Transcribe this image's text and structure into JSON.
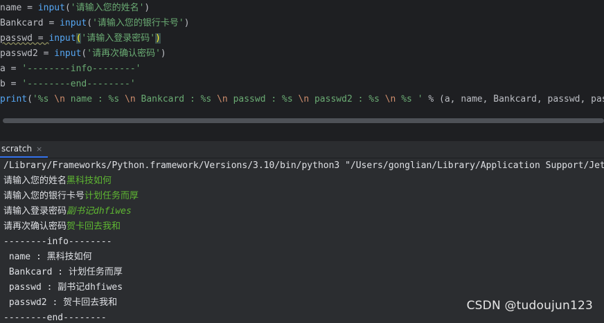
{
  "editor": {
    "line1": {
      "lhs": "name = ",
      "fn": "input",
      "open": "(",
      "str": "'请输入您的姓名'",
      "close": ")"
    },
    "line2": {
      "lhs": "Bankcard = ",
      "fn": "input",
      "open": "(",
      "str": "'请输入您的银行卡号'",
      "close": ")"
    },
    "line3": {
      "lhs": "passwd = ",
      "fn": "input",
      "open": "(",
      "str": "'请输入登录密码'",
      "close": ")"
    },
    "line4": {
      "lhs": "passwd2 = ",
      "fn": "input",
      "open": "(",
      "str": "'请再次确认密码'",
      "close": ")"
    },
    "line5": {
      "lhs": "a = ",
      "str": "'--------info--------'"
    },
    "line6": {
      "lhs": "b = ",
      "str": "'--------end--------'"
    },
    "line7": {
      "fn": "print",
      "open": "(",
      "s1": "'%s ",
      "e1": "\\n",
      "s2": " name : %s ",
      "e2": "\\n",
      "s3": " Bankcard : %s ",
      "e3": "\\n",
      "s4": " passwd : %s ",
      "e4": "\\n",
      "s5": " passwd2 : %s ",
      "e5": "\\n",
      "s6": " %s '",
      "rest": " % (a, name, Bankcard, passwd, pas"
    }
  },
  "tab": {
    "label": "scratch",
    "close": "×"
  },
  "console": {
    "cmd": "/Library/Frameworks/Python.framework/Versions/3.10/bin/python3 \"/Users/gonglian/Library/Application Support/Jet",
    "prompt1": "请输入您的姓名",
    "answer1": "黑科技如何",
    "prompt2": "请输入您的银行卡号",
    "answer2": "计划任务而厚",
    "prompt3": "请输入登录密码",
    "answer3": "副书记dhfiwes",
    "prompt4": "请再次确认密码",
    "answer4": "贺卡回去我和",
    "info": "--------info--------",
    "out_name": " name : 黑科技如何",
    "out_bank": " Bankcard : 计划任务而厚",
    "out_pw": " passwd : 副书记dhfiwes",
    "out_pw2": " passwd2 : 贺卡回去我和",
    "end": "--------end--------"
  },
  "watermark": "CSDN @tudoujun123"
}
